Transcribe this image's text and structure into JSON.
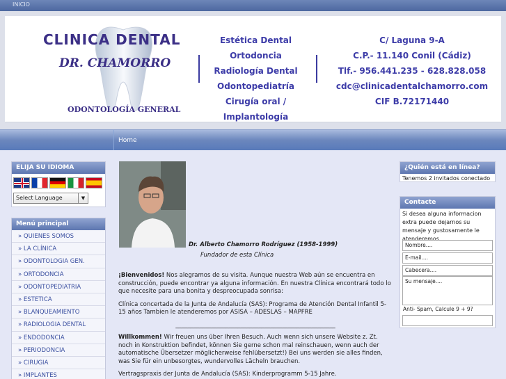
{
  "topbar": {
    "link": "INICIO"
  },
  "banner": {
    "brand_line1": "CLINICA DENTAL",
    "brand_line2": "DR. CHAMORRO",
    "brand_line3": "ODONTOLOGÍA GENERAL",
    "services": [
      "Estética Dental",
      "Ortodoncia",
      "Radiología Dental",
      "Odontopediatría",
      "Cirugía oral / Implantología"
    ],
    "contact": [
      "C/ Laguna 9-A",
      "C.P.- 11.140 Conil (Cádiz)",
      "Tlf.- 956.441.235 - 628.828.058",
      "cdc@clinicadentalchamorro.com",
      "CIF B.72171440"
    ]
  },
  "nav": {
    "home": "Home"
  },
  "language_panel": {
    "title": "ELIJA SU IDIOMA",
    "select_value": "Select Language"
  },
  "menu": {
    "title": "Menú principal",
    "items": [
      "» QUIENES SOMOS",
      "» LA CLÍNICA",
      "» ODONTOLOGIA GEN.",
      "» ORTODONCIA",
      "» ODONTOPEDIATRIA",
      "» ESTETICA",
      "» BLANQUEAMIENTO",
      "» RADIOLOGIA DENTAL",
      "» ENDODONCIA",
      "» PERIODONCIA",
      "» CIRUGIA",
      "» IMPLANTES"
    ]
  },
  "main": {
    "caption_name": "Dr. Alberto Chamorro Rodríguez (1958-1999)",
    "caption_role": "Fundador de esta Clínica",
    "welcome_bold": "¡Bienvenidos!",
    "welcome_text": " Nos alegramos de su visita. Aunque nuestra Web aún se encuentra en construcción, puede encontrar ya alguna información. En nuestra Clínica encontrará todo lo que necesite para una bonita y despreocupada sonrisa:",
    "concertada": "Clínica concertada de la Junta de Andalucía (SAS): Programa de Atención Dental Infantil 5-15 años Tambien le atenderemos por ASISA – ADESLAS – MAPFRE",
    "separator": "______________________________________________________",
    "de_bold": "Willkommen!",
    "de_text": " Wir freuen uns über Ihren Besuch. Auch wenn sich unsere Website z. Zt. noch in Konstruktion befindet, können Sie gerne schon mal reinschauen, wenn auch der automatische Übersetzer möglicherweise fehlübersetzt!) Bei uns werden sie alles finden, was Sie für ein unbesorgtes, wundervolles Lächeln brauchen.",
    "de_praxis": "Vertragspraxis der Junta de Andalucía (SAS): Kinderprogramm 5-15 Jahre."
  },
  "online_panel": {
    "title": "¿Quién está en línea?",
    "text": "Tenemos 2 invitados conectado"
  },
  "contact_panel": {
    "title": "Contacte",
    "text": "Si desea alguna informacion extra puede dejarnos su mensaje y gustosamente le atenderemos.",
    "name_placeholder": "Nombre....",
    "email_placeholder": "E-mail....",
    "subject_placeholder": "Cabecera....",
    "message_placeholder": "Su mensaje....",
    "spam_label": "Anti- Spam, Calcule 9 + 9?"
  }
}
